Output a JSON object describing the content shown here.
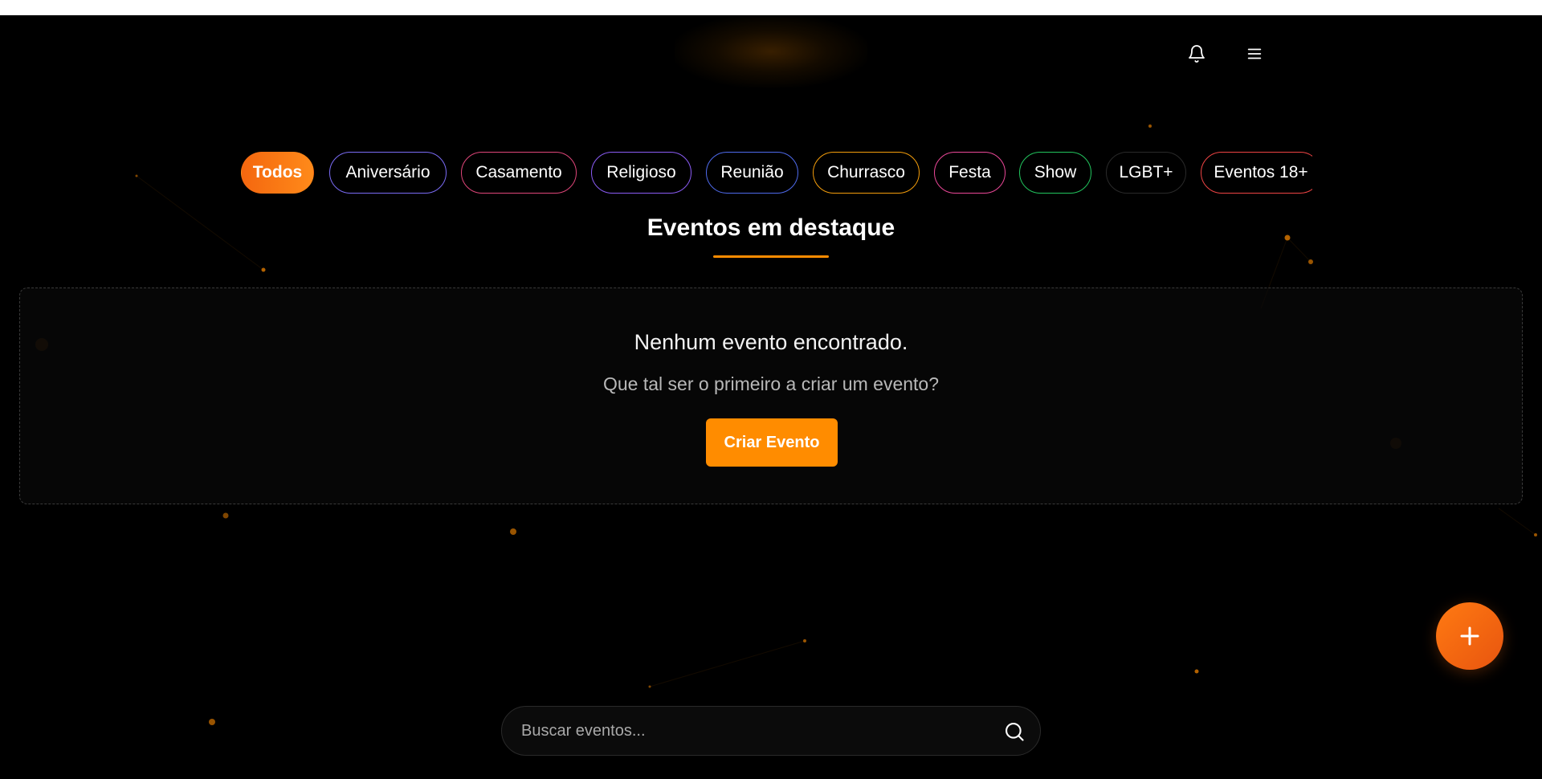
{
  "header": {
    "notifications_icon": "bell-icon",
    "menu_icon": "menu-icon"
  },
  "categories": [
    {
      "label": "Todos",
      "active": true,
      "color": "#ff8c00"
    },
    {
      "label": "Aniversário",
      "active": false,
      "color": "#7b6cf6"
    },
    {
      "label": "Casamento",
      "active": false,
      "color": "#e0467a"
    },
    {
      "label": "Religioso",
      "active": false,
      "color": "#8b5cf6"
    },
    {
      "label": "Reunião",
      "active": false,
      "color": "#4f6bed"
    },
    {
      "label": "Churrasco",
      "active": false,
      "color": "#f59e0b"
    },
    {
      "label": "Festa",
      "active": false,
      "color": "#ec4899"
    },
    {
      "label": "Show",
      "active": false,
      "color": "#22c55e"
    },
    {
      "label": "LGBT+",
      "active": false,
      "color": "#2a2a2a"
    },
    {
      "label": "Eventos 18+",
      "active": false,
      "color": "#ef4444"
    }
  ],
  "featured": {
    "title": "Eventos em destaque",
    "empty_title": "Nenhum evento encontrado.",
    "empty_subtitle": "Que tal ser o primeiro a criar um evento?",
    "create_label": "Criar Evento"
  },
  "fab": {
    "icon": "plus-icon"
  },
  "search": {
    "placeholder": "Buscar eventos...",
    "value": "",
    "icon": "search-icon"
  },
  "colors": {
    "accent": "#ff8c00",
    "background": "#000000"
  }
}
